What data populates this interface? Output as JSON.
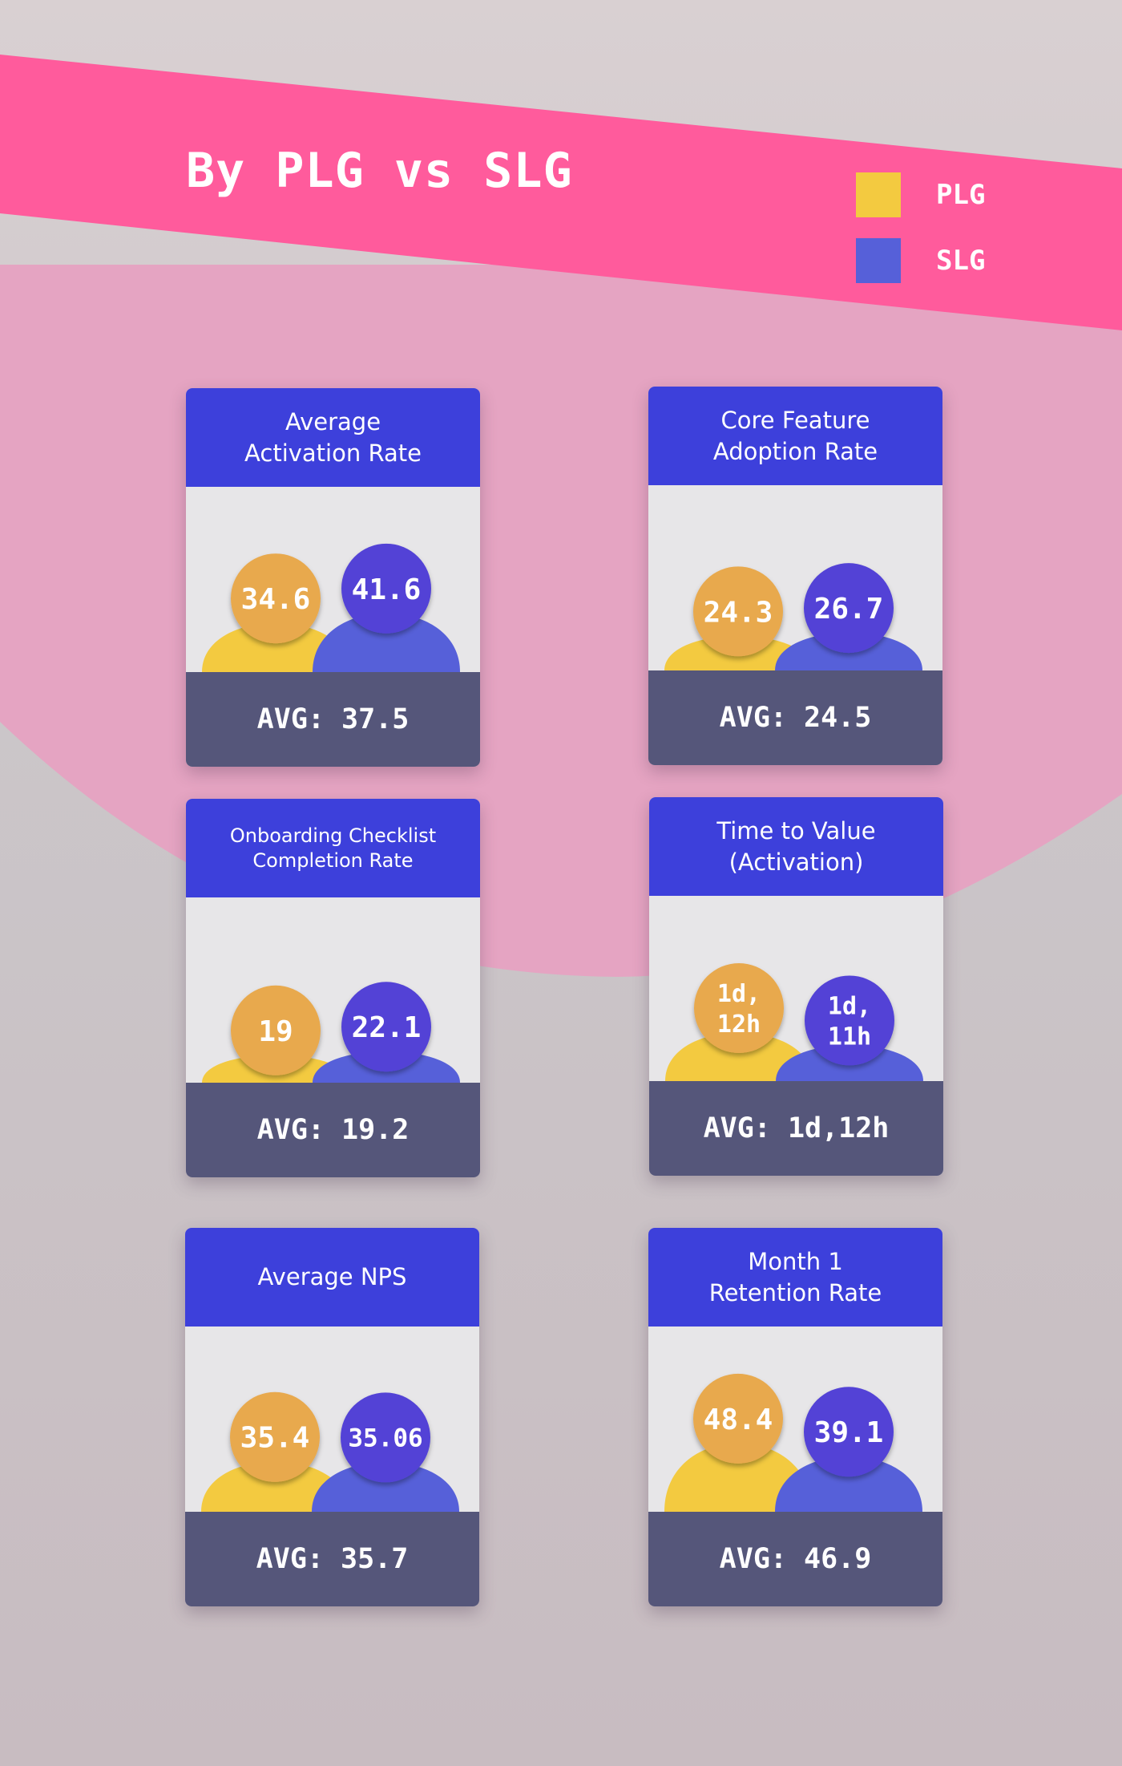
{
  "title": "By PLG vs SLG",
  "colors": {
    "banner": "#ff5b9c",
    "blob": "#e5a4c2",
    "plg_body": "#f3ca40",
    "plg_bubble": "#e8a94e",
    "slg_body": "#5660d9",
    "slg_bubble": "#5243d6",
    "card_header": "#3d40db",
    "card_footer": "#55567a"
  },
  "legend": [
    {
      "label": "PLG",
      "color": "#f3ca40"
    },
    {
      "label": "SLG",
      "color": "#5660d9"
    }
  ],
  "chart_data": [
    {
      "type": "bar",
      "title": "Average\nActivation Rate",
      "categories": [
        "PLG",
        "SLG"
      ],
      "values": [
        34.6,
        41.6
      ],
      "labels": [
        "34.6",
        "41.6"
      ],
      "avg_label": "AVG: 37.5"
    },
    {
      "type": "bar",
      "title": "Core Feature\nAdoption Rate",
      "categories": [
        "PLG",
        "SLG"
      ],
      "values": [
        24.3,
        26.7
      ],
      "labels": [
        "24.3",
        "26.7"
      ],
      "avg_label": "AVG: 24.5"
    },
    {
      "type": "bar",
      "title": "Onboarding Checklist\nCompletion Rate",
      "categories": [
        "PLG",
        "SLG"
      ],
      "values": [
        19,
        22.1
      ],
      "labels": [
        "19",
        "22.1"
      ],
      "avg_label": "AVG: 19.2"
    },
    {
      "type": "bar",
      "title": "Time to Value\n(Activation)",
      "categories": [
        "PLG",
        "SLG"
      ],
      "values": [
        1.5,
        1.458
      ],
      "labels": [
        "1d,\n12h",
        "1d,\n11h"
      ],
      "avg_label": "AVG: 1d,12h"
    },
    {
      "type": "bar",
      "title": "Average NPS",
      "categories": [
        "PLG",
        "SLG"
      ],
      "values": [
        35.4,
        35.06
      ],
      "labels": [
        "35.4",
        "35.06"
      ],
      "avg_label": "AVG: 35.7"
    },
    {
      "type": "bar",
      "title": "Month 1\nRetention Rate",
      "categories": [
        "PLG",
        "SLG"
      ],
      "values": [
        48.4,
        39.1
      ],
      "labels": [
        "48.4",
        "39.1"
      ],
      "avg_label": "AVG: 46.9"
    }
  ]
}
